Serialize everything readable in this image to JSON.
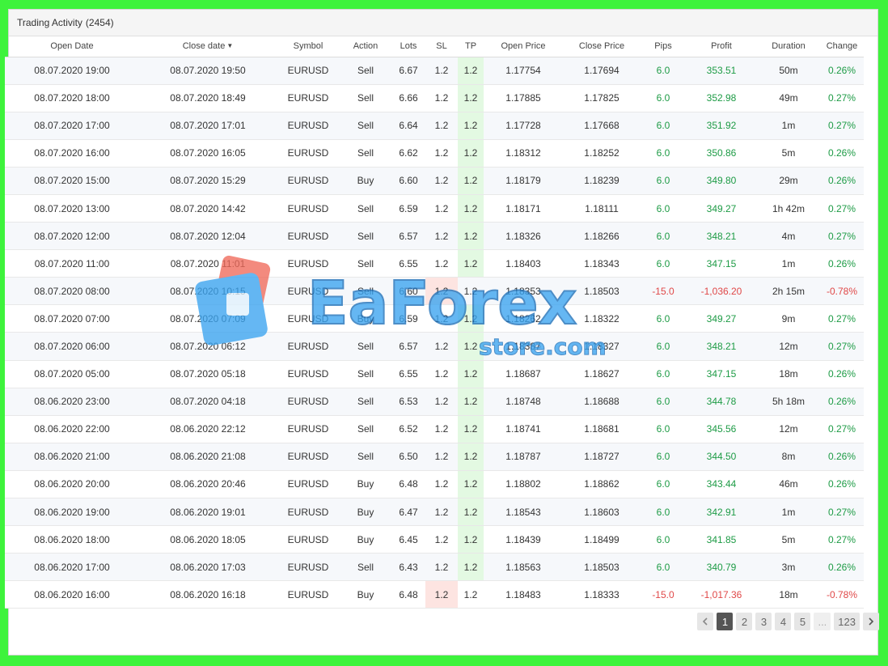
{
  "header": {
    "title": "Trading Activity",
    "count": "(2454)"
  },
  "columns": [
    {
      "key": "open_date",
      "label": "Open Date",
      "sort": ""
    },
    {
      "key": "close_date",
      "label": "Close date",
      "sort": "▼"
    },
    {
      "key": "symbol",
      "label": "Symbol",
      "sort": ""
    },
    {
      "key": "action",
      "label": "Action",
      "sort": ""
    },
    {
      "key": "lots",
      "label": "Lots",
      "sort": ""
    },
    {
      "key": "sl",
      "label": "SL",
      "sort": ""
    },
    {
      "key": "tp",
      "label": "TP",
      "sort": ""
    },
    {
      "key": "open_price",
      "label": "Open Price",
      "sort": ""
    },
    {
      "key": "close_price",
      "label": "Close Price",
      "sort": ""
    },
    {
      "key": "pips",
      "label": "Pips",
      "sort": ""
    },
    {
      "key": "profit",
      "label": "Profit",
      "sort": ""
    },
    {
      "key": "duration",
      "label": "Duration",
      "sort": ""
    },
    {
      "key": "change",
      "label": "Change",
      "sort": ""
    }
  ],
  "rows": [
    {
      "open_date": "08.07.2020 19:00",
      "close_date": "08.07.2020 19:50",
      "symbol": "EURUSD",
      "action": "Sell",
      "lots": "6.67",
      "sl": "1.2",
      "tp": "1.2",
      "open_price": "1.17754",
      "close_price": "1.17694",
      "pips": "6.0",
      "profit": "353.51",
      "duration": "50m",
      "change": "0.26%",
      "result": "win"
    },
    {
      "open_date": "08.07.2020 18:00",
      "close_date": "08.07.2020 18:49",
      "symbol": "EURUSD",
      "action": "Sell",
      "lots": "6.66",
      "sl": "1.2",
      "tp": "1.2",
      "open_price": "1.17885",
      "close_price": "1.17825",
      "pips": "6.0",
      "profit": "352.98",
      "duration": "49m",
      "change": "0.27%",
      "result": "win"
    },
    {
      "open_date": "08.07.2020 17:00",
      "close_date": "08.07.2020 17:01",
      "symbol": "EURUSD",
      "action": "Sell",
      "lots": "6.64",
      "sl": "1.2",
      "tp": "1.2",
      "open_price": "1.17728",
      "close_price": "1.17668",
      "pips": "6.0",
      "profit": "351.92",
      "duration": "1m",
      "change": "0.27%",
      "result": "win"
    },
    {
      "open_date": "08.07.2020 16:00",
      "close_date": "08.07.2020 16:05",
      "symbol": "EURUSD",
      "action": "Sell",
      "lots": "6.62",
      "sl": "1.2",
      "tp": "1.2",
      "open_price": "1.18312",
      "close_price": "1.18252",
      "pips": "6.0",
      "profit": "350.86",
      "duration": "5m",
      "change": "0.26%",
      "result": "win"
    },
    {
      "open_date": "08.07.2020 15:00",
      "close_date": "08.07.2020 15:29",
      "symbol": "EURUSD",
      "action": "Buy",
      "lots": "6.60",
      "sl": "1.2",
      "tp": "1.2",
      "open_price": "1.18179",
      "close_price": "1.18239",
      "pips": "6.0",
      "profit": "349.80",
      "duration": "29m",
      "change": "0.26%",
      "result": "win"
    },
    {
      "open_date": "08.07.2020 13:00",
      "close_date": "08.07.2020 14:42",
      "symbol": "EURUSD",
      "action": "Sell",
      "lots": "6.59",
      "sl": "1.2",
      "tp": "1.2",
      "open_price": "1.18171",
      "close_price": "1.18111",
      "pips": "6.0",
      "profit": "349.27",
      "duration": "1h 42m",
      "change": "0.27%",
      "result": "win"
    },
    {
      "open_date": "08.07.2020 12:00",
      "close_date": "08.07.2020 12:04",
      "symbol": "EURUSD",
      "action": "Sell",
      "lots": "6.57",
      "sl": "1.2",
      "tp": "1.2",
      "open_price": "1.18326",
      "close_price": "1.18266",
      "pips": "6.0",
      "profit": "348.21",
      "duration": "4m",
      "change": "0.27%",
      "result": "win"
    },
    {
      "open_date": "08.07.2020 11:00",
      "close_date": "08.07.2020 11:01",
      "symbol": "EURUSD",
      "action": "Sell",
      "lots": "6.55",
      "sl": "1.2",
      "tp": "1.2",
      "open_price": "1.18403",
      "close_price": "1.18343",
      "pips": "6.0",
      "profit": "347.15",
      "duration": "1m",
      "change": "0.26%",
      "result": "win"
    },
    {
      "open_date": "08.07.2020 08:00",
      "close_date": "08.07.2020 10:15",
      "symbol": "EURUSD",
      "action": "Sell",
      "lots": "6.60",
      "sl": "1.2",
      "tp": "1.2",
      "open_price": "1.18353",
      "close_price": "1.18503",
      "pips": "-15.0",
      "profit": "-1,036.20",
      "duration": "2h 15m",
      "change": "-0.78%",
      "result": "loss"
    },
    {
      "open_date": "08.07.2020 07:00",
      "close_date": "08.07.2020 07:09",
      "symbol": "EURUSD",
      "action": "Buy",
      "lots": "6.59",
      "sl": "1.2",
      "tp": "1.2",
      "open_price": "1.18262",
      "close_price": "1.18322",
      "pips": "6.0",
      "profit": "349.27",
      "duration": "9m",
      "change": "0.27%",
      "result": "win"
    },
    {
      "open_date": "08.07.2020 06:00",
      "close_date": "08.07.2020 06:12",
      "symbol": "EURUSD",
      "action": "Sell",
      "lots": "6.57",
      "sl": "1.2",
      "tp": "1.2",
      "open_price": "1.18387",
      "close_price": "1.18327",
      "pips": "6.0",
      "profit": "348.21",
      "duration": "12m",
      "change": "0.27%",
      "result": "win"
    },
    {
      "open_date": "08.07.2020 05:00",
      "close_date": "08.07.2020 05:18",
      "symbol": "EURUSD",
      "action": "Sell",
      "lots": "6.55",
      "sl": "1.2",
      "tp": "1.2",
      "open_price": "1.18687",
      "close_price": "1.18627",
      "pips": "6.0",
      "profit": "347.15",
      "duration": "18m",
      "change": "0.26%",
      "result": "win"
    },
    {
      "open_date": "08.06.2020 23:00",
      "close_date": "08.07.2020 04:18",
      "symbol": "EURUSD",
      "action": "Sell",
      "lots": "6.53",
      "sl": "1.2",
      "tp": "1.2",
      "open_price": "1.18748",
      "close_price": "1.18688",
      "pips": "6.0",
      "profit": "344.78",
      "duration": "5h 18m",
      "change": "0.26%",
      "result": "win"
    },
    {
      "open_date": "08.06.2020 22:00",
      "close_date": "08.06.2020 22:12",
      "symbol": "EURUSD",
      "action": "Sell",
      "lots": "6.52",
      "sl": "1.2",
      "tp": "1.2",
      "open_price": "1.18741",
      "close_price": "1.18681",
      "pips": "6.0",
      "profit": "345.56",
      "duration": "12m",
      "change": "0.27%",
      "result": "win"
    },
    {
      "open_date": "08.06.2020 21:00",
      "close_date": "08.06.2020 21:08",
      "symbol": "EURUSD",
      "action": "Sell",
      "lots": "6.50",
      "sl": "1.2",
      "tp": "1.2",
      "open_price": "1.18787",
      "close_price": "1.18727",
      "pips": "6.0",
      "profit": "344.50",
      "duration": "8m",
      "change": "0.26%",
      "result": "win"
    },
    {
      "open_date": "08.06.2020 20:00",
      "close_date": "08.06.2020 20:46",
      "symbol": "EURUSD",
      "action": "Buy",
      "lots": "6.48",
      "sl": "1.2",
      "tp": "1.2",
      "open_price": "1.18802",
      "close_price": "1.18862",
      "pips": "6.0",
      "profit": "343.44",
      "duration": "46m",
      "change": "0.26%",
      "result": "win"
    },
    {
      "open_date": "08.06.2020 19:00",
      "close_date": "08.06.2020 19:01",
      "symbol": "EURUSD",
      "action": "Buy",
      "lots": "6.47",
      "sl": "1.2",
      "tp": "1.2",
      "open_price": "1.18543",
      "close_price": "1.18603",
      "pips": "6.0",
      "profit": "342.91",
      "duration": "1m",
      "change": "0.27%",
      "result": "win"
    },
    {
      "open_date": "08.06.2020 18:00",
      "close_date": "08.06.2020 18:05",
      "symbol": "EURUSD",
      "action": "Buy",
      "lots": "6.45",
      "sl": "1.2",
      "tp": "1.2",
      "open_price": "1.18439",
      "close_price": "1.18499",
      "pips": "6.0",
      "profit": "341.85",
      "duration": "5m",
      "change": "0.27%",
      "result": "win"
    },
    {
      "open_date": "08.06.2020 17:00",
      "close_date": "08.06.2020 17:03",
      "symbol": "EURUSD",
      "action": "Sell",
      "lots": "6.43",
      "sl": "1.2",
      "tp": "1.2",
      "open_price": "1.18563",
      "close_price": "1.18503",
      "pips": "6.0",
      "profit": "340.79",
      "duration": "3m",
      "change": "0.26%",
      "result": "win"
    },
    {
      "open_date": "08.06.2020 16:00",
      "close_date": "08.06.2020 16:18",
      "symbol": "EURUSD",
      "action": "Buy",
      "lots": "6.48",
      "sl": "1.2",
      "tp": "1.2",
      "open_price": "1.18483",
      "close_price": "1.18333",
      "pips": "-15.0",
      "profit": "-1,017.36",
      "duration": "18m",
      "change": "-0.78%",
      "result": "loss"
    }
  ],
  "pagination": {
    "prev_icon": "chevron-left-icon",
    "pages": [
      "1",
      "2",
      "3",
      "4",
      "5"
    ],
    "active": "1",
    "ellipsis": "...",
    "last": "123",
    "next_icon": "chevron-right-icon"
  },
  "watermark": {
    "brand_top": "EaForex",
    "brand_bottom": "store.com"
  },
  "colors": {
    "positive": "#1d9b45",
    "negative": "#e04848",
    "tp_highlight": "#e3f9e2",
    "sl_highlight": "#fde4e1",
    "frame": "#3ef33c",
    "watermark_blue": "#3aa4f0",
    "watermark_red": "#f06a5a"
  }
}
